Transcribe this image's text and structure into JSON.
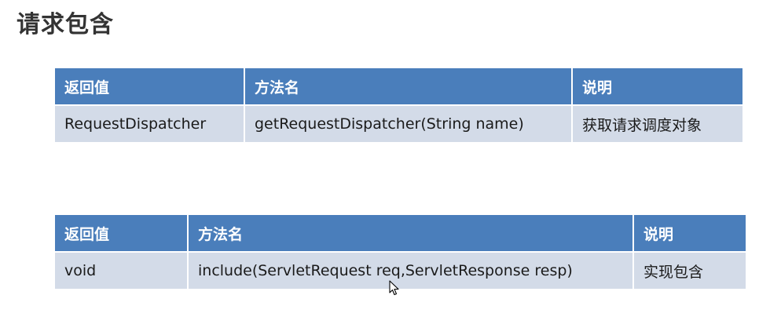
{
  "title": "请求包含",
  "tables": [
    {
      "headers": [
        "返回值",
        "方法名",
        "说明"
      ],
      "row": [
        "RequestDispatcher",
        "getRequestDispatcher(String  name)",
        "获取请求调度对象"
      ]
    },
    {
      "headers": [
        "返回值",
        "方法名",
        "说明"
      ],
      "row": [
        "void",
        "include(ServletRequest  req,ServletResponse  resp)",
        "实现包含"
      ]
    }
  ],
  "cursor_icon": "mouse-pointer-icon"
}
